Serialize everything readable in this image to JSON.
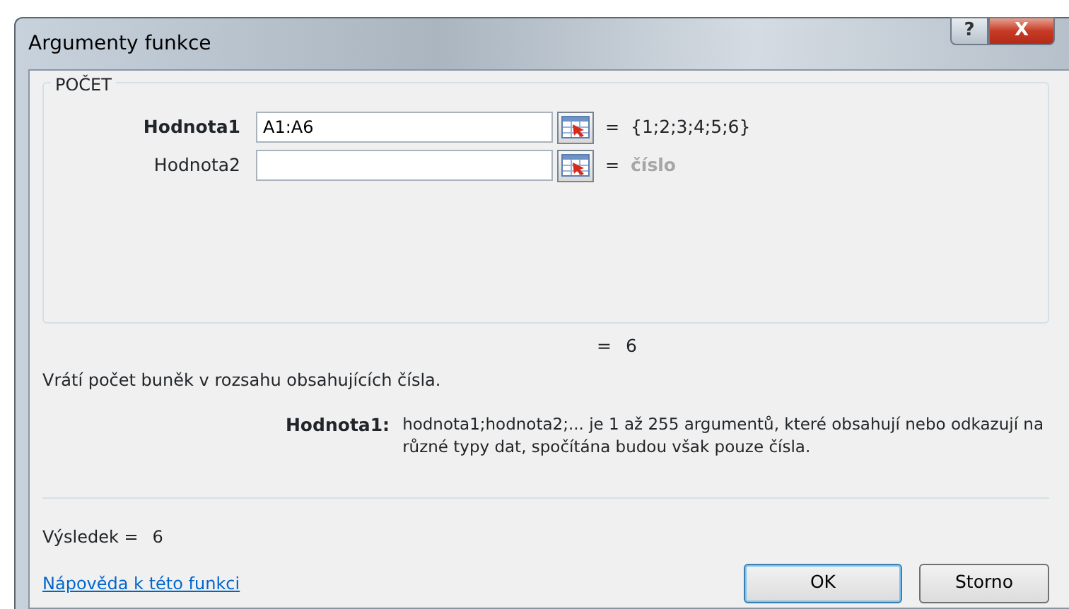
{
  "window": {
    "title": "Argumenty funkce",
    "help_button": "?",
    "close_button": "X"
  },
  "function_name": "POČET",
  "arguments": [
    {
      "label": "Hodnota1",
      "required": true,
      "value": "A1:A6",
      "result": "{1;2;3;4;5;6}",
      "result_is_hint": false
    },
    {
      "label": "Hodnota2",
      "required": false,
      "result": "číslo",
      "result_is_hint": true
    }
  ],
  "equals": "=",
  "formula_result": "6",
  "description": "Vrátí počet buněk v rozsahu obsahujících čísla.",
  "argument_help": {
    "label": "Hodnota1:",
    "text": "hodnota1;hodnota2;... je 1 až 255 argumentů, které obsahují nebo odkazují na různé typy dat, spočítána budou však pouze čísla."
  },
  "result_label": "Výsledek =",
  "result_value": "6",
  "help_link": "Nápověda k této funkci",
  "buttons": [
    "OK",
    "Storno"
  ]
}
